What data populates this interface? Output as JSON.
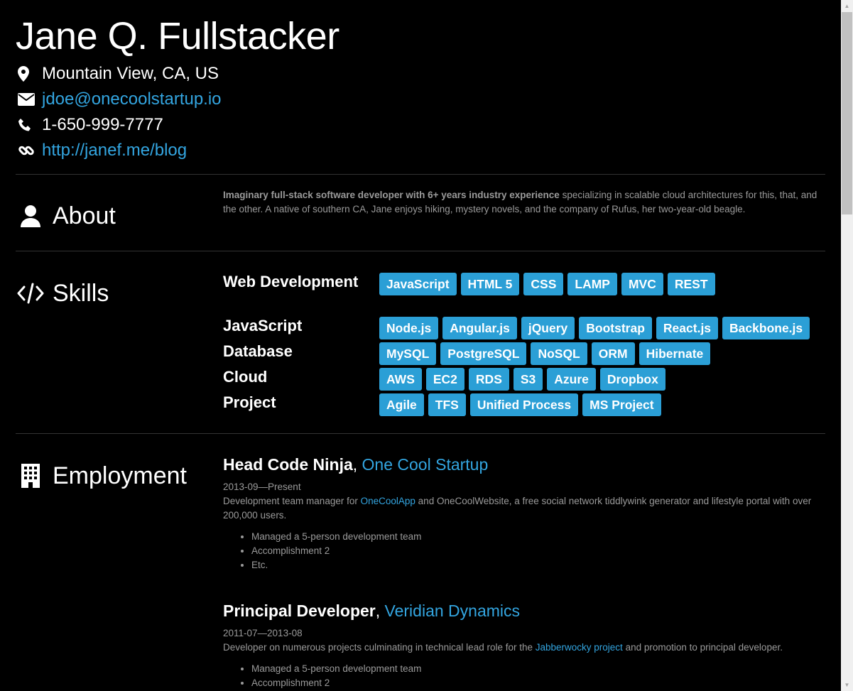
{
  "header": {
    "name": "Jane Q. Fullstacker",
    "location": "Mountain View, CA, US",
    "email": "jdoe@onecoolstartup.io",
    "phone": "1-650-999-7777",
    "website": "http://janef.me/blog",
    "icons": [
      "map-marker-icon",
      "envelope-icon",
      "phone-icon",
      "link-icon"
    ]
  },
  "about": {
    "title": "About",
    "summary_bold": "Imaginary full-stack software developer with 6+ years industry experience",
    "summary_rest": " specializing in scalable cloud architectures for this, that, and the other. A native of southern CA, Jane enjoys hiking, mystery novels, and the company of Rufus, her two-year-old beagle."
  },
  "skills": {
    "title": "Skills",
    "groups": [
      {
        "name": "Web Development",
        "keywords": [
          "JavaScript",
          "HTML 5",
          "CSS",
          "LAMP",
          "MVC",
          "REST"
        ]
      },
      {
        "name": "JavaScript",
        "keywords": [
          "Node.js",
          "Angular.js",
          "jQuery",
          "Bootstrap",
          "React.js",
          "Backbone.js"
        ]
      },
      {
        "name": "Database",
        "keywords": [
          "MySQL",
          "PostgreSQL",
          "NoSQL",
          "ORM",
          "Hibernate"
        ]
      },
      {
        "name": "Cloud",
        "keywords": [
          "AWS",
          "EC2",
          "RDS",
          "S3",
          "Azure",
          "Dropbox"
        ]
      },
      {
        "name": "Project",
        "keywords": [
          "Agile",
          "TFS",
          "Unified Process",
          "MS Project"
        ]
      }
    ]
  },
  "employment": {
    "title": "Employment",
    "jobs": [
      {
        "position": "Head Code Ninja",
        "company": "One Cool Startup",
        "dates": "2013-09—Present",
        "summary_pre": "Development team manager for ",
        "summary_link": "OneCoolApp",
        "summary_post": " and OneCoolWebsite, a free social network tiddlywink generator and lifestyle portal with over 200,000 users.",
        "highlights": [
          "Managed a 5-person development team",
          "Accomplishment 2",
          "Etc."
        ]
      },
      {
        "position": "Principal Developer",
        "company": "Veridian Dynamics",
        "dates": "2011-07—2013-08",
        "summary_pre": "Developer on numerous projects culminating in technical lead role for the ",
        "summary_link": "Jabberwocky project",
        "summary_post": " and promotion to principal developer.",
        "highlights": [
          "Managed a 5-person development team",
          "Accomplishment 2"
        ]
      }
    ]
  },
  "colors": {
    "background": "#000000",
    "accent": "#2b9fd6",
    "link": "#33a5e0",
    "muted": "#9a9a9a"
  }
}
